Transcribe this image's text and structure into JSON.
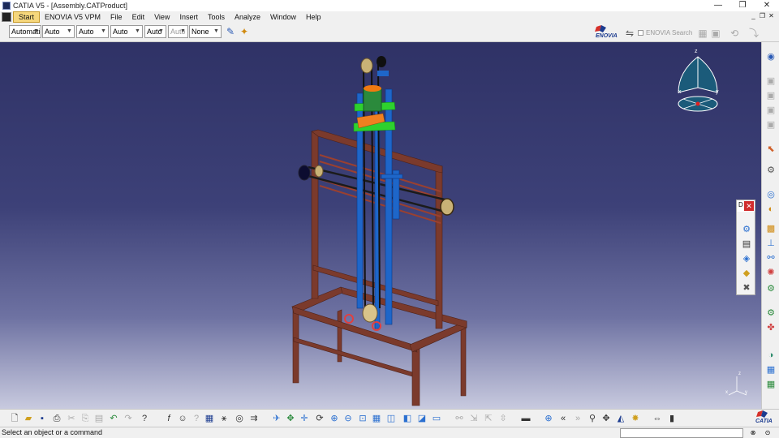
{
  "window": {
    "title": "CATIA V5 - [Assembly.CATProduct]",
    "minimize": "—",
    "restore": "❐",
    "close": "✕"
  },
  "menu": {
    "items": [
      "Start",
      "ENOVIA V5 VPM",
      "File",
      "Edit",
      "View",
      "Insert",
      "Tools",
      "Analyze",
      "Window",
      "Help"
    ],
    "doc_controls": [
      "_",
      "❐",
      "✕"
    ]
  },
  "properties_toolbar": {
    "combos": [
      "Automatic",
      "Auto",
      "Auto",
      "Auto",
      "Auto",
      "Auto",
      "None"
    ]
  },
  "enovia": {
    "logo_text": "ENOVIA",
    "search_label": "ENOVIA Search"
  },
  "compass": {
    "x_label": "x",
    "y_label": "y",
    "z_label": "z"
  },
  "floating_toolbar": {
    "label": "D",
    "close": "✕"
  },
  "catia_logo_text": "CATIA",
  "status": {
    "message": "Select an object or a command"
  },
  "colors": {
    "frame": "#7a3a2a",
    "rod_blue": "#1a6fd8",
    "accent_green": "#2fd02f",
    "motor_orange": "#f07a10",
    "pulley": "#c8b070"
  }
}
